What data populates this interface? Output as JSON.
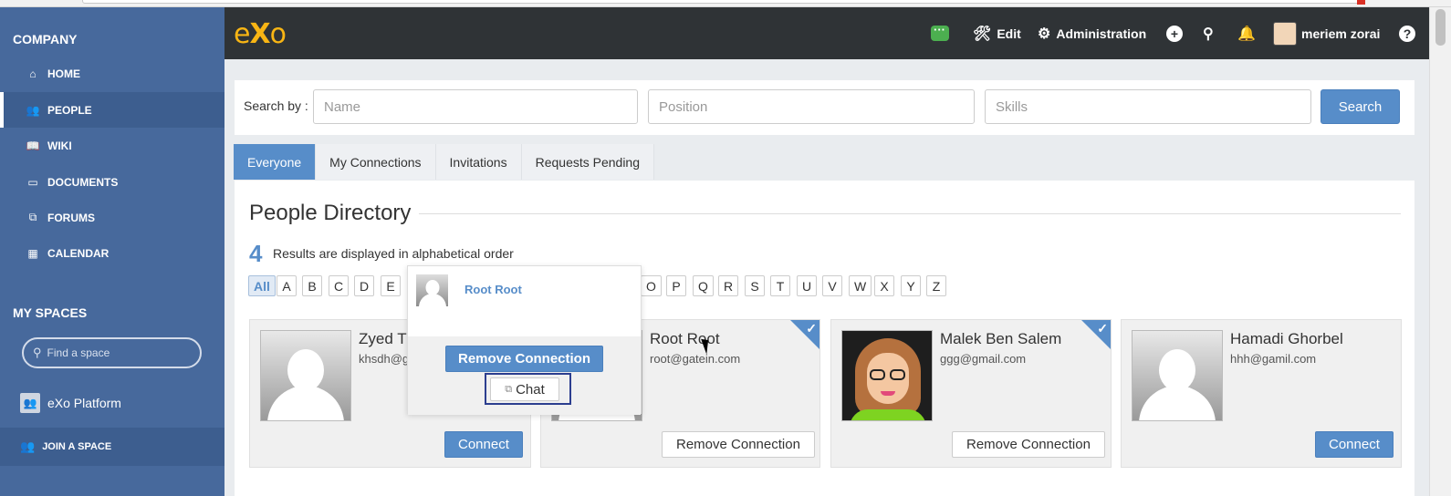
{
  "sidebar": {
    "company_title": "COMPANY",
    "items": [
      {
        "label": "HOME",
        "icon": "home-icon"
      },
      {
        "label": "PEOPLE",
        "icon": "people-icon",
        "active": true
      },
      {
        "label": "WIKI",
        "icon": "book-icon"
      },
      {
        "label": "DOCUMENTS",
        "icon": "folder-icon"
      },
      {
        "label": "FORUMS",
        "icon": "forum-icon"
      },
      {
        "label": "CALENDAR",
        "icon": "calendar-icon"
      }
    ],
    "spaces_title": "MY SPACES",
    "find_space_placeholder": "Find a space",
    "space_name": "eXo Platform",
    "join_label": "JOIN A SPACE"
  },
  "topbar": {
    "logo_e": "e",
    "logo_x": "X",
    "logo_o": "o",
    "edit_label": "Edit",
    "admin_label": "Administration",
    "user_name": "meriem zorai",
    "help_label": "?"
  },
  "search": {
    "label": "Search by :",
    "name_placeholder": "Name",
    "position_placeholder": "Position",
    "skills_placeholder": "Skills",
    "button_label": "Search"
  },
  "tabs": [
    "Everyone",
    "My Connections",
    "Invitations",
    "Requests Pending"
  ],
  "directory": {
    "title": "People Directory",
    "count": "4",
    "results_text": "Results are displayed in alphabetical order",
    "letters": [
      "All",
      "A",
      "B",
      "C",
      "D",
      "E",
      "O",
      "P",
      "Q",
      "R",
      "S",
      "T",
      "U",
      "V",
      "W",
      "X",
      "Y",
      "Z"
    ]
  },
  "cards": [
    {
      "name": "Zyed Tr",
      "email": "khsdh@g",
      "button": "Connect"
    },
    {
      "name": "Root Root",
      "email": "root@gatein.com",
      "button": "Remove Connection"
    },
    {
      "name": "Malek Ben Salem",
      "email": "ggg@gmail.com",
      "button": "Remove Connection"
    },
    {
      "name": "Hamadi Ghorbel",
      "email": "hhh@gamil.com",
      "button": "Connect"
    }
  ],
  "popover": {
    "name": "Root Root",
    "remove_label": "Remove Connection",
    "chat_label": "Chat"
  },
  "colors": {
    "sidebar": "#47699c",
    "topbar": "#2f3336",
    "accent": "#578dc9",
    "logo": "#f8b514"
  }
}
